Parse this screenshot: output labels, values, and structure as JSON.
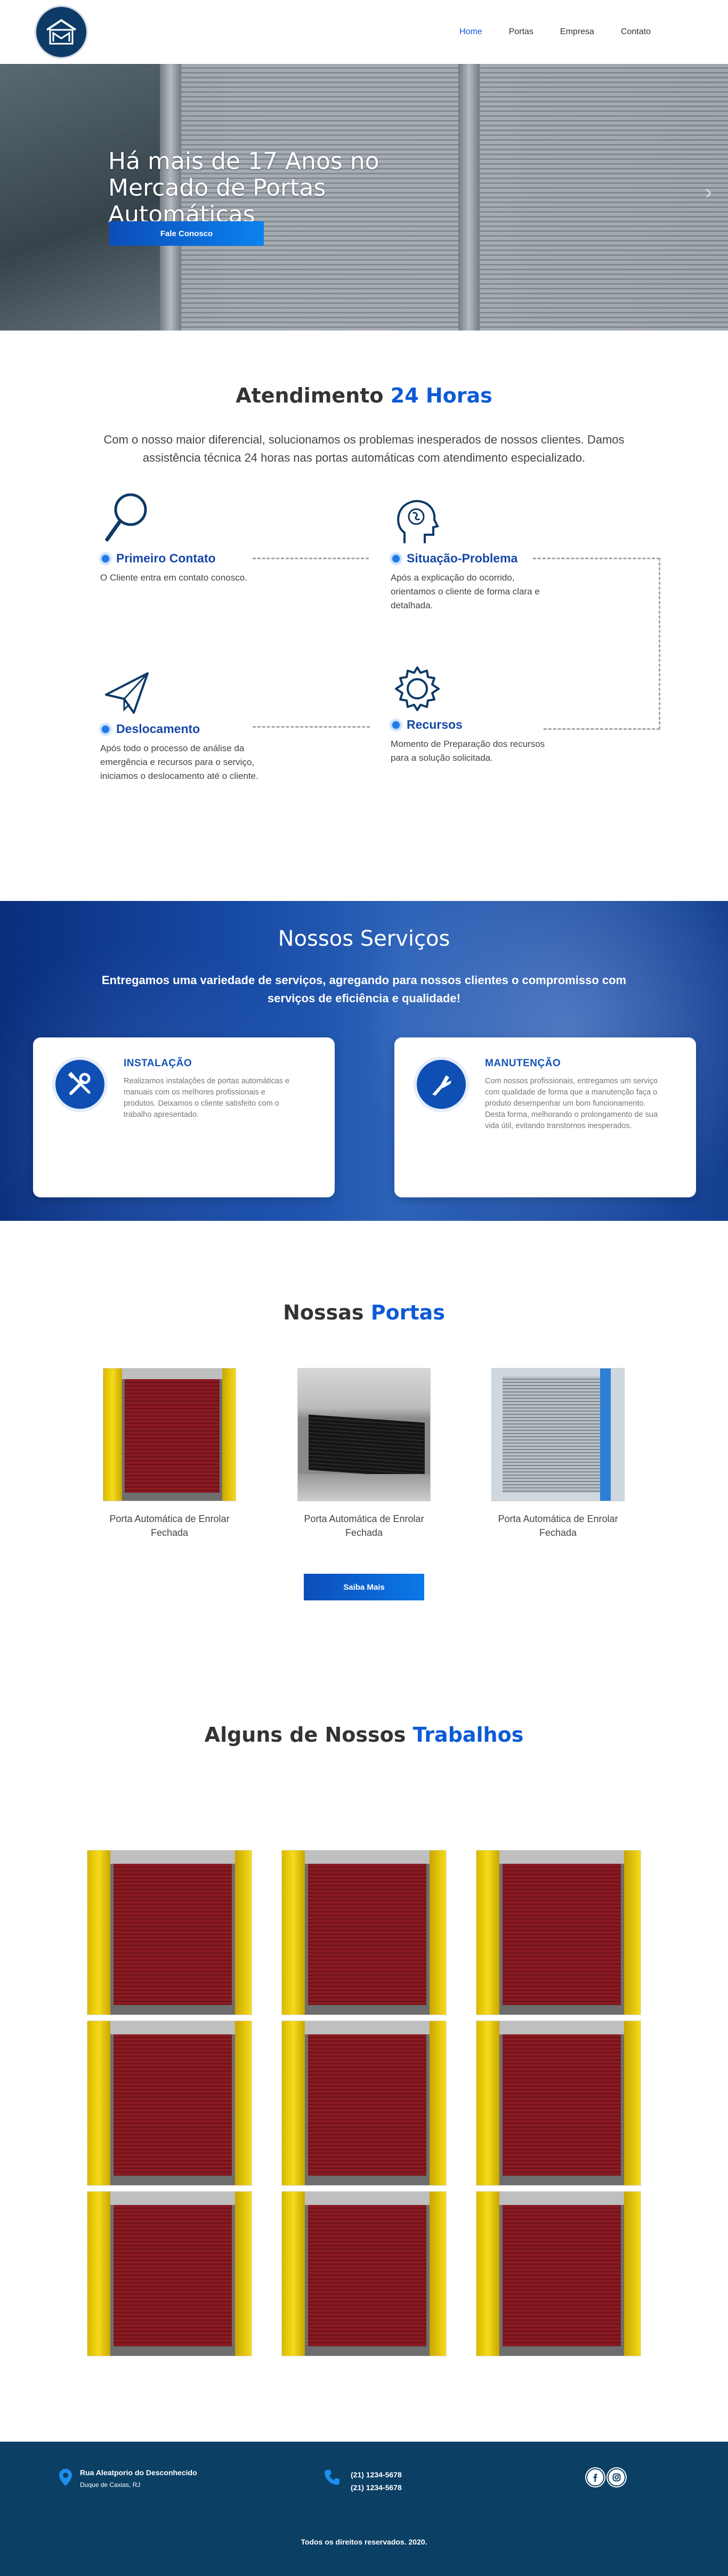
{
  "nav": {
    "items": [
      {
        "label": "Home",
        "active": true
      },
      {
        "label": "Portas",
        "active": false
      },
      {
        "label": "Empresa",
        "active": false
      },
      {
        "label": "Contato",
        "active": false
      }
    ]
  },
  "hero": {
    "title": "Há mais de 17 Anos no Mercado de Portas Automáticas",
    "button": "Fale Conosco"
  },
  "atendimento": {
    "title_plain": "Atendimento ",
    "title_accent": "24 Horas",
    "intro": "Com o nosso maior diferencial, solucionamos os problemas inesperados de nossos clientes. Damos assistência técnica 24 horas nas portas automáticas com atendimento especializado.",
    "steps": [
      {
        "title": "Primeiro Contato",
        "text": "O Cliente entra em contato conosco.",
        "icon": "magnifier-icon"
      },
      {
        "title": "Situação-Problema",
        "text": "Após a explicação do ocorrido, orientamos o cliente de forma clara e detalhada.",
        "icon": "brain-icon"
      },
      {
        "title": "Recursos",
        "text": "Momento de Preparação dos recursos para a solução solicitada.",
        "icon": "gear-icon"
      },
      {
        "title": "Deslocamento",
        "text": "Após todo o processo de análise da emergência e recursos para o serviço, iniciamos o deslocamento até o cliente.",
        "icon": "paper-plane-icon"
      }
    ]
  },
  "servicos": {
    "title": "Nossos Serviços",
    "lead": "Entregamos uma variedade de serviços, agregando para nossos clientes o compromisso com serviços de eficiência e qualidade!",
    "cards": [
      {
        "title": "INSTALAÇÃO",
        "text": "Realizamos instalações de portas automáticas e manuais com os melhores profissionais e produtos. Deixamos o cliente satisfeito com o trabalho apresentado.",
        "icon": "tools-icon"
      },
      {
        "title": "MANUTENÇÃO",
        "text": "Com nossos profissionais, entregamos um serviço com qualidade de forma que a manutenção faça o produto desempenhar um bom funcionamento. Desta forma, melhorando o prolongamento de sua vida útil, evitando transtornos inesperados.",
        "icon": "pliers-icon"
      }
    ]
  },
  "portas": {
    "title_plain": "Nossas ",
    "title_accent": "Portas",
    "items": [
      {
        "caption": "Porta Automática de Enrolar Fechada"
      },
      {
        "caption": "Porta Automática de Enrolar Fechada"
      },
      {
        "caption": "Porta Automática de Enrolar Fechada"
      }
    ],
    "button": "Saiba Mais"
  },
  "trabalhos": {
    "title_plain": "Alguns de Nossos ",
    "title_accent": "Trabalhos"
  },
  "footer": {
    "address_line1": "Rua Aleatporio do Desconhecido",
    "address_line2": "Duque de Caxias, RJ",
    "phone1": "(21) 1234-5678",
    "phone2": "(21) 1234-5678",
    "copyright": "Todos os direitos reservados. 2020."
  },
  "colors": {
    "accent": "#0d5bd6",
    "footer_bg": "#0b3f64",
    "step_title": "#1748a8"
  }
}
